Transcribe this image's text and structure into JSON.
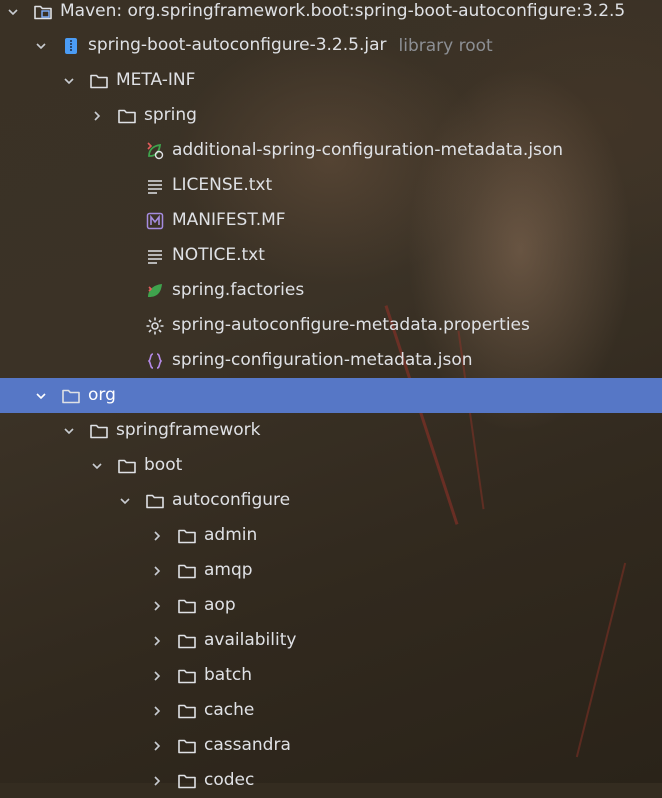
{
  "colors": {
    "selection": "#5677c6",
    "text": "#dfe1e5",
    "hint": "#8c8f94",
    "folder": "#dfe1e5",
    "jar": "#4b9cf5",
    "spring_green": "#3fa34d",
    "manifest_purple": "#a58ce0",
    "json_purple": "#b48ae6"
  },
  "tree": [
    {
      "label": "Maven: org.springframework.boot:spring-boot-autoconfigure:3.2.5",
      "hint": "",
      "icon": "library-icon",
      "expanded": true
    },
    {
      "label": "spring-boot-autoconfigure-3.2.5.jar",
      "hint": "library root",
      "icon": "jar-icon",
      "expanded": true
    },
    {
      "label": "META-INF",
      "hint": "",
      "icon": "folder-icon",
      "expanded": true
    },
    {
      "label": "spring",
      "hint": "",
      "icon": "folder-icon",
      "expanded": false
    },
    {
      "label": "additional-spring-configuration-metadata.json",
      "hint": "",
      "icon": "spring-json-icon"
    },
    {
      "label": "LICENSE.txt",
      "hint": "",
      "icon": "text-file-icon"
    },
    {
      "label": "MANIFEST.MF",
      "hint": "",
      "icon": "manifest-icon"
    },
    {
      "label": "NOTICE.txt",
      "hint": "",
      "icon": "text-file-icon"
    },
    {
      "label": "spring.factories",
      "hint": "",
      "icon": "spring-factories-icon"
    },
    {
      "label": "spring-autoconfigure-metadata.properties",
      "hint": "",
      "icon": "gear-icon"
    },
    {
      "label": "spring-configuration-metadata.json",
      "hint": "",
      "icon": "json-icon"
    },
    {
      "label": "org",
      "hint": "",
      "icon": "folder-icon",
      "expanded": true,
      "selected": true
    },
    {
      "label": "springframework",
      "hint": "",
      "icon": "folder-icon",
      "expanded": true
    },
    {
      "label": "boot",
      "hint": "",
      "icon": "folder-icon",
      "expanded": true
    },
    {
      "label": "autoconfigure",
      "hint": "",
      "icon": "folder-icon",
      "expanded": true
    },
    {
      "label": "admin",
      "hint": "",
      "icon": "folder-icon",
      "expanded": false
    },
    {
      "label": "amqp",
      "hint": "",
      "icon": "folder-icon",
      "expanded": false
    },
    {
      "label": "aop",
      "hint": "",
      "icon": "folder-icon",
      "expanded": false
    },
    {
      "label": "availability",
      "hint": "",
      "icon": "folder-icon",
      "expanded": false
    },
    {
      "label": "batch",
      "hint": "",
      "icon": "folder-icon",
      "expanded": false
    },
    {
      "label": "cache",
      "hint": "",
      "icon": "folder-icon",
      "expanded": false
    },
    {
      "label": "cassandra",
      "hint": "",
      "icon": "folder-icon",
      "expanded": false
    },
    {
      "label": "codec",
      "hint": "",
      "icon": "folder-icon",
      "expanded": false
    }
  ]
}
